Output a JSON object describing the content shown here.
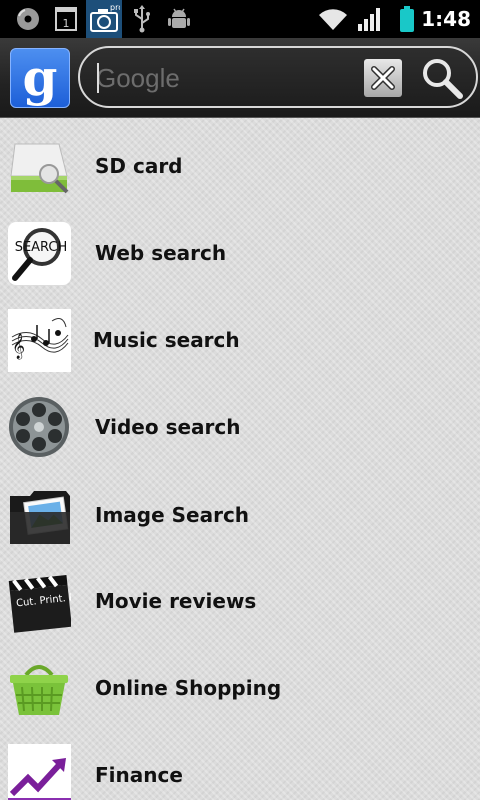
{
  "status_bar": {
    "time": "1:48",
    "icons": [
      "cd-icon",
      "screen-icon",
      "camera-pro-icon",
      "usb-icon",
      "android-debug-icon",
      "wifi-icon",
      "signal-icon",
      "battery-icon"
    ]
  },
  "search": {
    "logo_letter": "g",
    "placeholder": "Google",
    "value": ""
  },
  "list": {
    "items": [
      {
        "label": "SD card",
        "icon": "sd-card-icon"
      },
      {
        "label": "Web search",
        "icon": "web-search-icon"
      },
      {
        "label": "Music search",
        "icon": "music-search-icon"
      },
      {
        "label": "Video search",
        "icon": "video-search-icon"
      },
      {
        "label": "Image Search",
        "icon": "image-search-icon"
      },
      {
        "label": "Movie reviews",
        "icon": "movie-reviews-icon"
      },
      {
        "label": "Online Shopping",
        "icon": "online-shopping-icon"
      },
      {
        "label": "Finance",
        "icon": "finance-icon"
      }
    ]
  },
  "icon_text": {
    "search_word": "SEARCH",
    "clapper_text": "Cut. Print. Review."
  },
  "colors": {
    "list_background": "#dcdcdc",
    "header_background": "#222222",
    "google_blue": "#1d5fd8",
    "battery": "#19c8c8"
  }
}
